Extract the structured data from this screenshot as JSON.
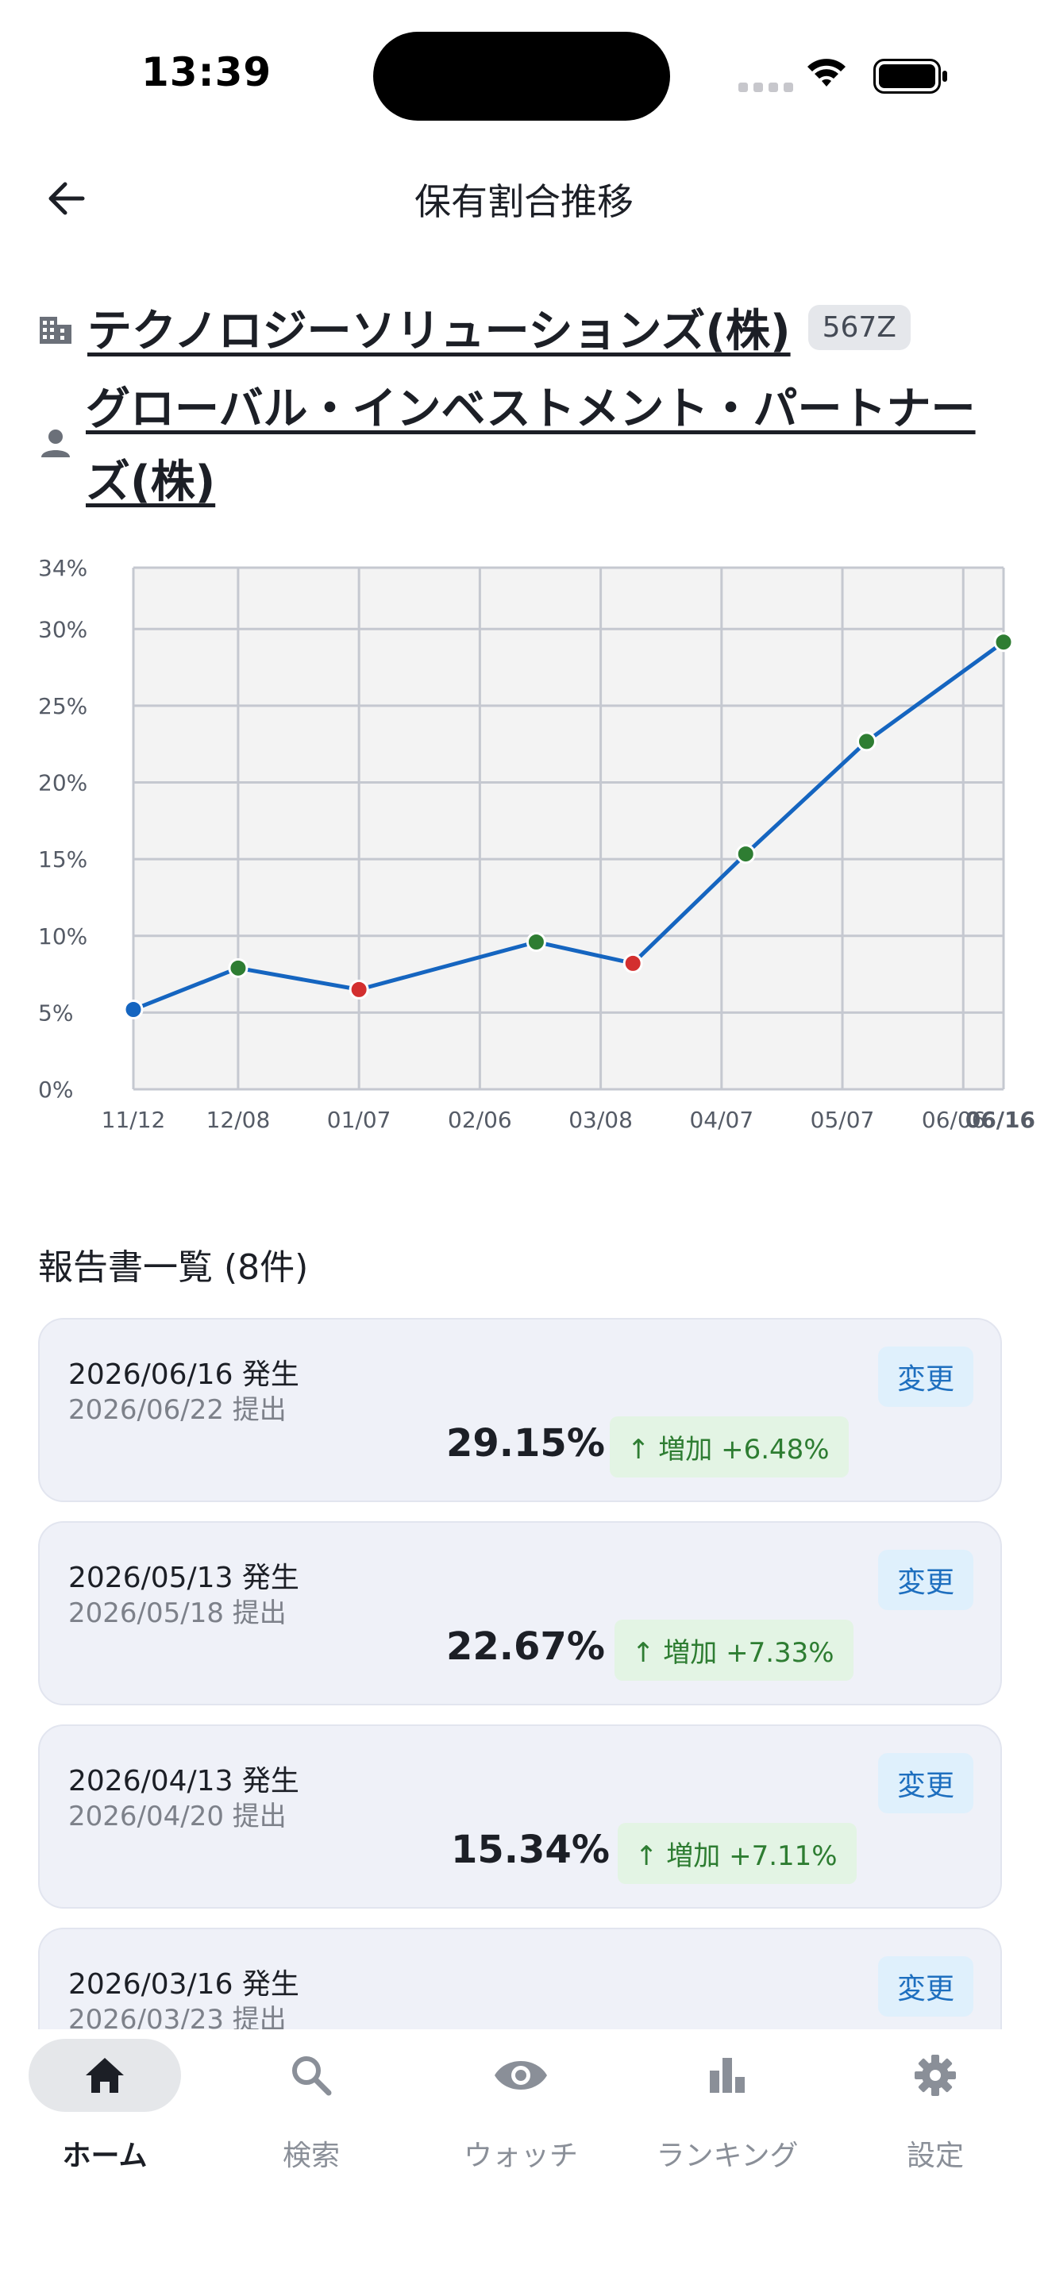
{
  "status_bar": {
    "time": "13:39"
  },
  "header": {
    "title": "保有割合推移",
    "back_icon": "arrow-left-icon"
  },
  "company": {
    "name": "テクノロジーソリューションズ(株)",
    "code": "567Z",
    "icon": "building-icon"
  },
  "holder": {
    "name": "グローバル・インベストメント・パートナーズ(株)",
    "icon": "person-icon"
  },
  "chart_data": {
    "type": "line",
    "y_ticks": [
      "0%",
      "5%",
      "10%",
      "15%",
      "20%",
      "25%",
      "30%",
      "34%"
    ],
    "ylim": [
      0,
      34
    ],
    "x_ticks": [
      "11/12",
      "12/08",
      "01/07",
      "02/06",
      "03/08",
      "04/07",
      "05/07",
      "06/06",
      "06/16"
    ],
    "x_tick_dates": [
      "2025-11-12",
      "2025-12-08",
      "2026-01-07",
      "2026-02-06",
      "2026-03-08",
      "2026-04-07",
      "2026-05-07",
      "2026-06-06",
      "2026-06-16"
    ],
    "xlim": [
      "2025-11-12",
      "2026-06-16"
    ],
    "grid": true,
    "series": [
      {
        "points": [
          {
            "x": "2025-11-12",
            "y": 5.2,
            "color": "#1565c0"
          },
          {
            "x": "2025-12-08",
            "y": 7.9,
            "color": "#2e7d32"
          },
          {
            "x": "2026-01-07",
            "y": 6.5,
            "color": "#d32f2f"
          },
          {
            "x": "2026-02-20",
            "y": 9.6,
            "color": "#2e7d32"
          },
          {
            "x": "2026-03-16",
            "y": 8.21,
            "color": "#d32f2f"
          },
          {
            "x": "2026-04-13",
            "y": 15.34,
            "color": "#2e7d32"
          },
          {
            "x": "2026-05-13",
            "y": 22.67,
            "color": "#2e7d32"
          },
          {
            "x": "2026-06-16",
            "y": 29.15,
            "color": "#2e7d32"
          }
        ]
      }
    ],
    "line_color": "#1565c0"
  },
  "reports": {
    "title": "報告書一覧 (8件)",
    "items": [
      {
        "occurred": "2026/06/16 発生",
        "filed": "2026/06/22 提出",
        "type": "変更",
        "ratio": "29.15%",
        "delta": "↑ 増加 +6.48%"
      },
      {
        "occurred": "2026/05/13 発生",
        "filed": "2026/05/18 提出",
        "type": "変更",
        "ratio": "22.67%",
        "delta": "↑ 増加 +7.33%"
      },
      {
        "occurred": "2026/04/13 発生",
        "filed": "2026/04/20 提出",
        "type": "変更",
        "ratio": "15.34%",
        "delta": "↑ 増加 +7.11%"
      },
      {
        "occurred": "2026/03/16 発生",
        "filed": "2026/03/23 提出",
        "type": "変更"
      }
    ]
  },
  "nav": {
    "items": [
      {
        "label": "ホーム",
        "icon": "home-icon",
        "active": true
      },
      {
        "label": "検索",
        "icon": "search-icon"
      },
      {
        "label": "ウォッチ",
        "icon": "eye-icon"
      },
      {
        "label": "ランキング",
        "icon": "bar-chart-icon"
      },
      {
        "label": "設定",
        "icon": "gear-icon"
      }
    ]
  }
}
